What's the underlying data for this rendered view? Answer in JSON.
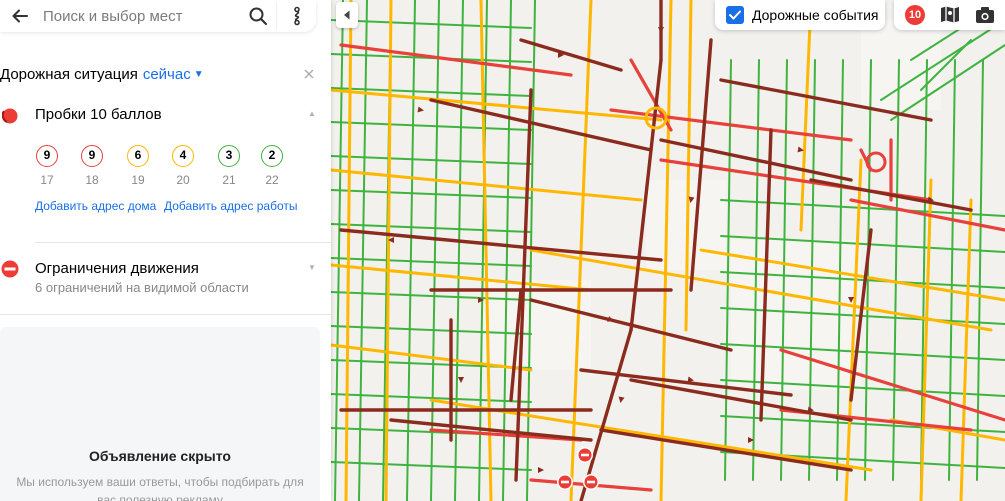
{
  "search": {
    "placeholder": "Поиск и выбор мест"
  },
  "traffic": {
    "title": "Дорожная ситуация",
    "time_link": "сейчас",
    "jams_title": "Пробки 10 баллов",
    "level": "10",
    "forecast": [
      {
        "score": "9",
        "hour": "17",
        "color": "#e8403a"
      },
      {
        "score": "9",
        "hour": "18",
        "color": "#e8403a"
      },
      {
        "score": "6",
        "hour": "19",
        "color": "#ffb700"
      },
      {
        "score": "4",
        "hour": "20",
        "color": "#ffb700"
      },
      {
        "score": "3",
        "hour": "21",
        "color": "#3fb33f"
      },
      {
        "score": "2",
        "hour": "22",
        "color": "#3fb33f"
      }
    ],
    "add_home": "Добавить адрес дома",
    "add_work": "Добавить адрес работы"
  },
  "restrictions": {
    "title": "Ограничения движения",
    "subtitle": "6 ограничений на видимой области"
  },
  "ad": {
    "title": "Объявление скрыто",
    "text": "Мы используем ваши ответы, чтобы подбирать для вас полезную рекламу"
  },
  "map": {
    "events_label": "Дорожные события",
    "events_checked": true,
    "traffic_colors": {
      "free": "#3fb33f",
      "slow": "#ffb700",
      "heavy": "#e8403a",
      "jam": "#8a2b1e"
    }
  }
}
